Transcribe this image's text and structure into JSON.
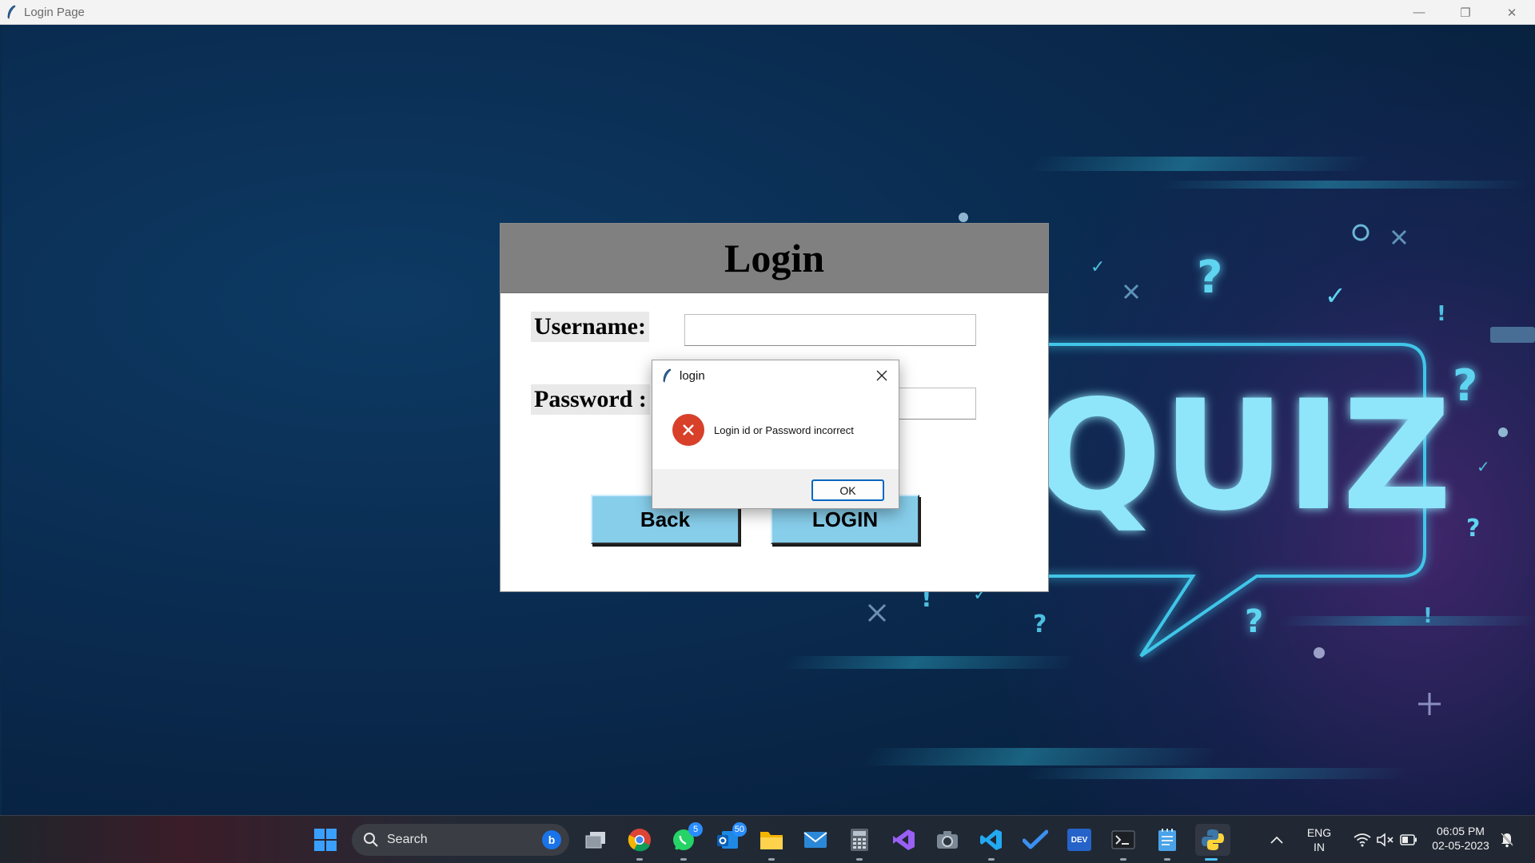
{
  "window": {
    "title": "Login Page",
    "controls": {
      "minimize": "—",
      "restore": "❐",
      "close": "✕"
    }
  },
  "background": {
    "quiz_text": "QUIZ",
    "question_mark": "?",
    "check_mark": "✓",
    "exclamation": "!"
  },
  "login": {
    "heading": "Login",
    "username_label": "Username:",
    "password_label": "Password :",
    "username_value": "",
    "password_value": "",
    "back_button": "Back",
    "login_button": "LOGIN"
  },
  "dialog": {
    "title": "login",
    "message": "Login id or Password incorrect",
    "ok_button": "OK",
    "icon": "error-icon"
  },
  "taskbar": {
    "search_label": "Search",
    "whatsapp_badge": "5",
    "outlook_badge": "50",
    "dev_label": "DEV",
    "language_line1": "ENG",
    "language_line2": "IN",
    "time": "06:05 PM",
    "date": "02-05-2023",
    "colors": {
      "accent": "#4cc2ff",
      "badge": "#2a8cff"
    }
  }
}
